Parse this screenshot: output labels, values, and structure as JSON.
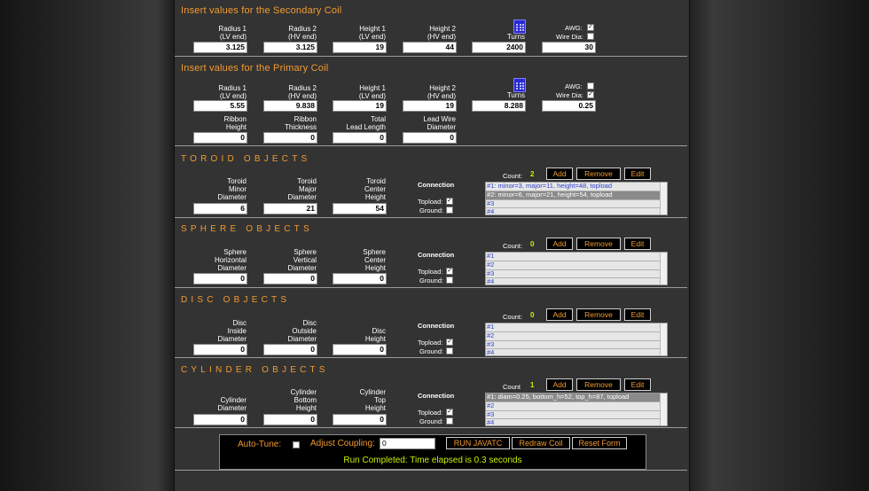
{
  "secondary": {
    "heading": "Insert values for the Secondary Coil",
    "fields": [
      {
        "label": "Radius 1\n(LV end)",
        "value": "3.125"
      },
      {
        "label": "Radius 2\n(HV end)",
        "value": "3.125"
      },
      {
        "label": "Height 1\n(LV end)",
        "value": "19"
      },
      {
        "label": "Height 2\n(HV end)",
        "value": "44"
      },
      {
        "label": "Turns",
        "value": "2400"
      }
    ],
    "awg_label": "AWG:",
    "awg_checked": true,
    "wire_label": "Wire Dia:",
    "wire_checked": false,
    "wire_value": "30"
  },
  "primary": {
    "heading": "Insert values for the Primary Coil",
    "fields": [
      {
        "label": "Radius 1\n(LV end)",
        "value": "5.55"
      },
      {
        "label": "Radius 2\n(HV end)",
        "value": "9.838"
      },
      {
        "label": "Height 1\n(LV end)",
        "value": "19"
      },
      {
        "label": "Height 2\n(HV end)",
        "value": "19"
      },
      {
        "label": "Turns",
        "value": "8.288"
      }
    ],
    "awg_label": "AWG:",
    "awg_checked": false,
    "wire_label": "Wire Dia:",
    "wire_checked": true,
    "wire_value": "0.25",
    "extra": [
      {
        "label": "Ribbon\nHeight",
        "value": "0"
      },
      {
        "label": "Ribbon\nThickness",
        "value": "0"
      },
      {
        "label": "Total\nLead Length",
        "value": "0"
      },
      {
        "label": "Lead Wire\nDiameter",
        "value": "0"
      }
    ]
  },
  "toroid": {
    "heading": "TOROID OBJECTS",
    "fields": [
      {
        "label": "Toroid\nMinor\nDiameter",
        "value": "6"
      },
      {
        "label": "Toroid\nMajor\nDiameter",
        "value": "21"
      },
      {
        "label": "Toroid\nCenter\nHeight",
        "value": "54"
      }
    ],
    "connection": "Connection",
    "topload": "Topload:",
    "ground": "Ground:",
    "topload_checked": true,
    "ground_checked": false,
    "count_label": "Count:",
    "count": "2",
    "items": [
      "#1: minor=3, major=11, height=48, topload",
      "#2: minor=6, major=21, height=54, topload",
      "#3",
      "#4"
    ],
    "selected": 1
  },
  "sphere": {
    "heading": "SPHERE OBJECTS",
    "fields": [
      {
        "label": "Sphere\nHorizontal\nDiameter",
        "value": "0"
      },
      {
        "label": "Sphere\nVertical\nDiameter",
        "value": "0"
      },
      {
        "label": "Sphere\nCenter\nHeight",
        "value": "0"
      }
    ],
    "connection": "Connection",
    "topload": "Topload:",
    "ground": "Ground:",
    "topload_checked": true,
    "ground_checked": false,
    "count_label": "Count:",
    "count": "0",
    "items": [
      "#1",
      "#2",
      "#3",
      "#4"
    ],
    "selected": -1
  },
  "disc": {
    "heading": "DISC OBJECTS",
    "fields": [
      {
        "label": "Disc\nInside\nDiameter",
        "value": "0"
      },
      {
        "label": "Disc\nOutside\nDiameter",
        "value": "0"
      },
      {
        "label": "Disc\nHeight",
        "value": "0"
      }
    ],
    "connection": "Connection",
    "topload": "Topload:",
    "ground": "Ground:",
    "topload_checked": true,
    "ground_checked": false,
    "count_label": "Count:",
    "count": "0",
    "items": [
      "#1",
      "#2",
      "#3",
      "#4"
    ],
    "selected": -1
  },
  "cylinder": {
    "heading": "CYLINDER OBJECTS",
    "fields": [
      {
        "label": "Cylinder\nDiameter",
        "value": "0"
      },
      {
        "label": "Cylinder\nBottom\nHeight",
        "value": "0"
      },
      {
        "label": "Cylinder\nTop\nHeight",
        "value": "0"
      }
    ],
    "connection": "Connection",
    "topload": "Topload:",
    "ground": "Ground:",
    "topload_checked": true,
    "ground_checked": false,
    "count_label": "Count",
    "count": "1",
    "items": [
      "#1: diam=0.25, bottom_h=52, top_h=87, topload",
      "#2",
      "#3",
      "#4"
    ],
    "selected": 0
  },
  "buttons": {
    "add": "Add",
    "remove": "Remove",
    "edit": "Edit"
  },
  "controls": {
    "autotune_label": "Auto-Tune:",
    "adjust_label": "Adjust Coupling:",
    "adjust_value": "0",
    "run": "RUN JAVATC",
    "redraw": "Redraw Coil",
    "reset": "Reset Form",
    "status": "Run Completed: Time elapsed is 0.3 seconds"
  },
  "colors": {
    "accent": "#f39a30",
    "count": "#c8f000",
    "panel": "#333333"
  }
}
